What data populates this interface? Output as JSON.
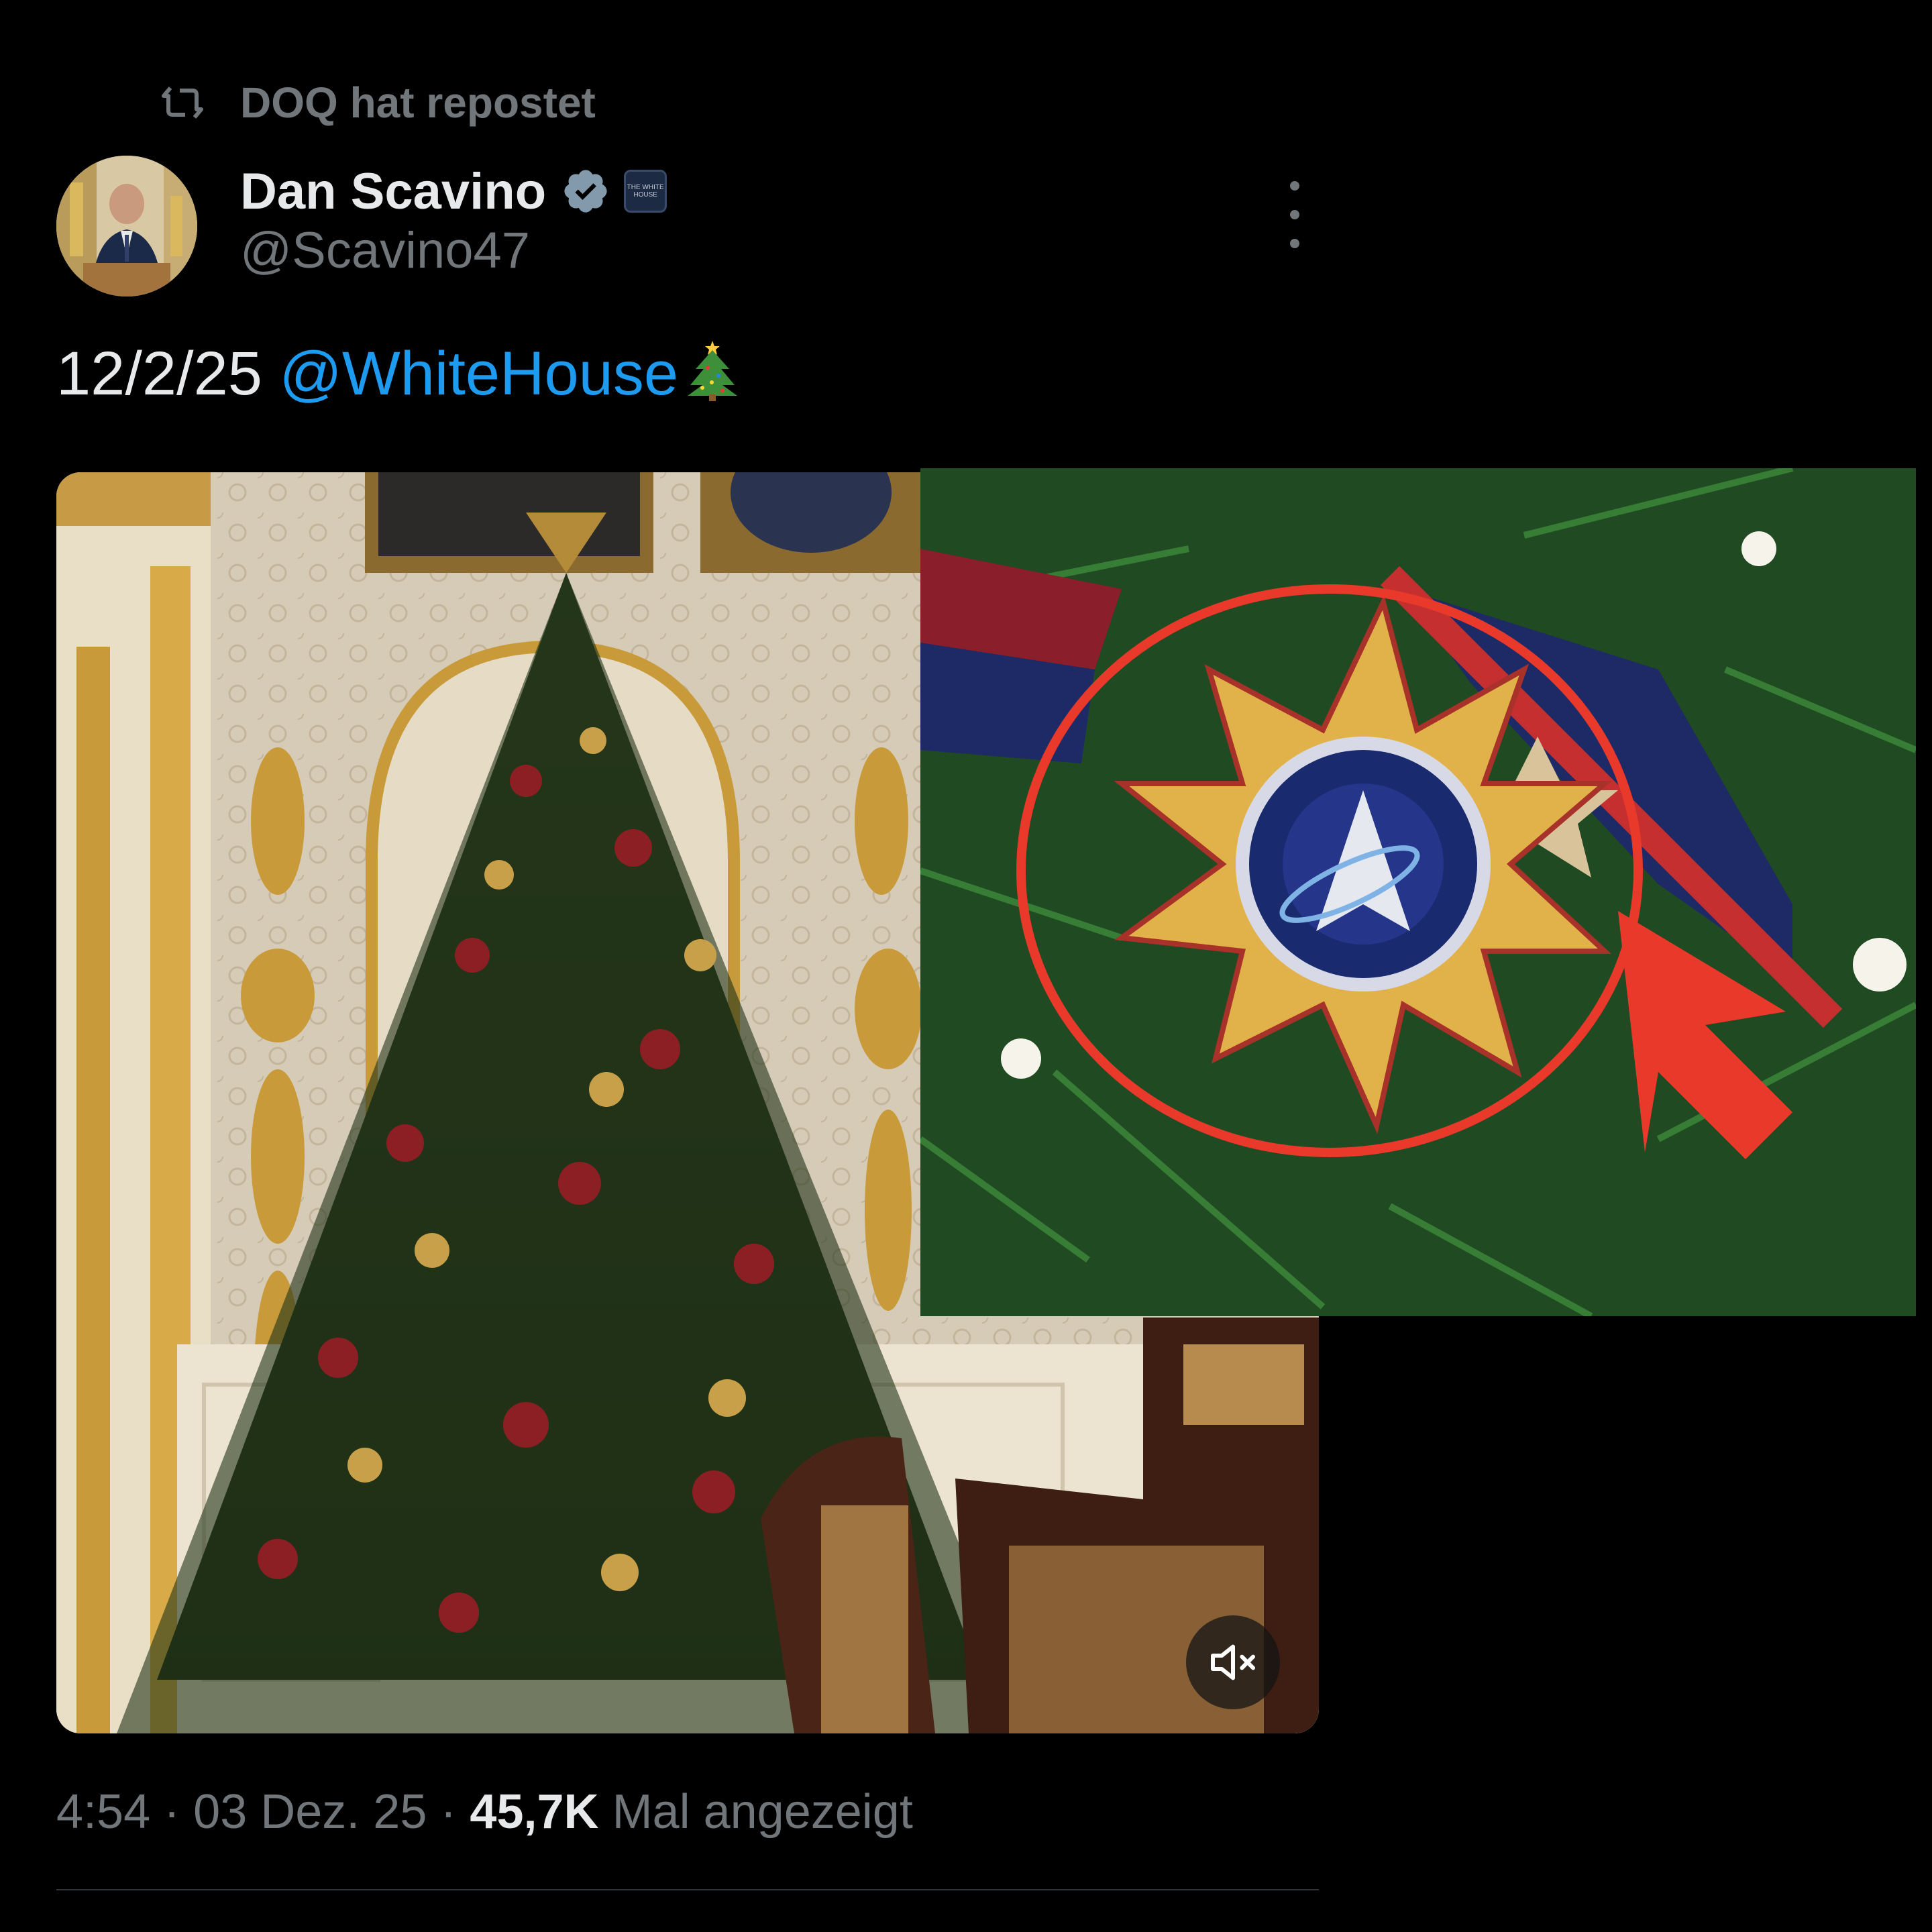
{
  "repost": {
    "text": "DOQ hat repostet",
    "icon": "repost-icon"
  },
  "author": {
    "name": "Dan Scavino",
    "handle": "@Scavino47",
    "verified_icon": "verified-badge-icon",
    "affiliation_badge_icon": "white-house-badge-icon",
    "affiliation_badge_text": "THE WHITE HOUSE"
  },
  "tweet": {
    "date_text": "12/2/25",
    "mention": "@WhiteHouse",
    "emoji": "christmas-tree-emoji"
  },
  "media": {
    "type": "video",
    "mute_icon": "muted-speaker-icon"
  },
  "meta": {
    "time": "4:54",
    "separator": "·",
    "date": "03 Dez. 25",
    "views_count": "45,7K",
    "views_label": "Mal angezeigt"
  },
  "colors": {
    "background": "#000000",
    "text_primary": "#e7e9ea",
    "text_secondary": "#71767b",
    "link": "#1d9bf0",
    "verified": "#829aab",
    "annotation_red": "#e8392b"
  }
}
